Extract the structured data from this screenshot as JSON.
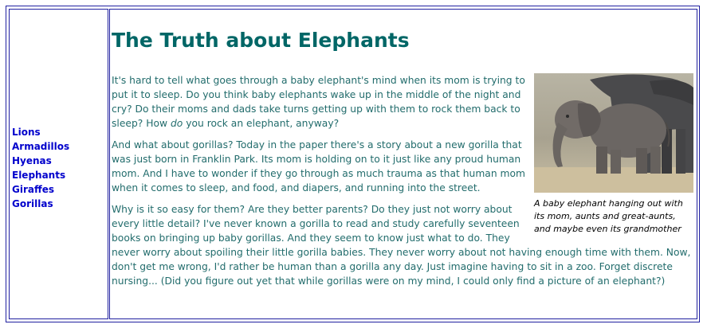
{
  "nav": {
    "items": [
      "Lions",
      "Armadillos",
      "Hyenas",
      "Elephants",
      "Giraffes",
      "Gorillas"
    ]
  },
  "main": {
    "title": "The Truth about Elephants",
    "figure": {
      "caption": "A baby elephant hanging out with its mom, aunts and great-aunts, and maybe even its grandmother"
    },
    "paragraphs": [
      {
        "before": "It's hard to tell what goes through a baby elephant's mind when its mom is trying to put it to sleep. Do you think baby elephants wake up in the middle of the night and cry? Do their moms and dads take turns getting up with them to rock them back to sleep? How ",
        "emphasis": "do",
        "after": " you rock an elephant, anyway?"
      },
      "And what about gorillas? Today in the paper there's a story about a new gorilla that was just born in Franklin Park. Its mom is holding on to it just like any proud human mom. And I have to wonder if they go through as much trauma as that human mom when it comes to sleep, and food, and diapers, and running into the street.",
      "Why is it so easy for them? Are they better parents? Do they just not worry about every little detail? I've never known a gorilla to read and study carefully seventeen books on bringing up baby gorillas. And they seem to know just what to do. They never worry about spoiling their little gorilla babies. They never worry about not having enough time with them. Now, don't get me wrong, I'd rather be human than a gorilla any day. Just imagine having to sit in a zoo. Forget discrete nursing... (Did you figure out yet that while gorillas were on my mind, I could only find a picture of an elephant?)"
    ]
  },
  "colors": {
    "border": "#2020a0",
    "link": "#0000cc",
    "title": "#006666",
    "body_text": "#226c6c"
  }
}
